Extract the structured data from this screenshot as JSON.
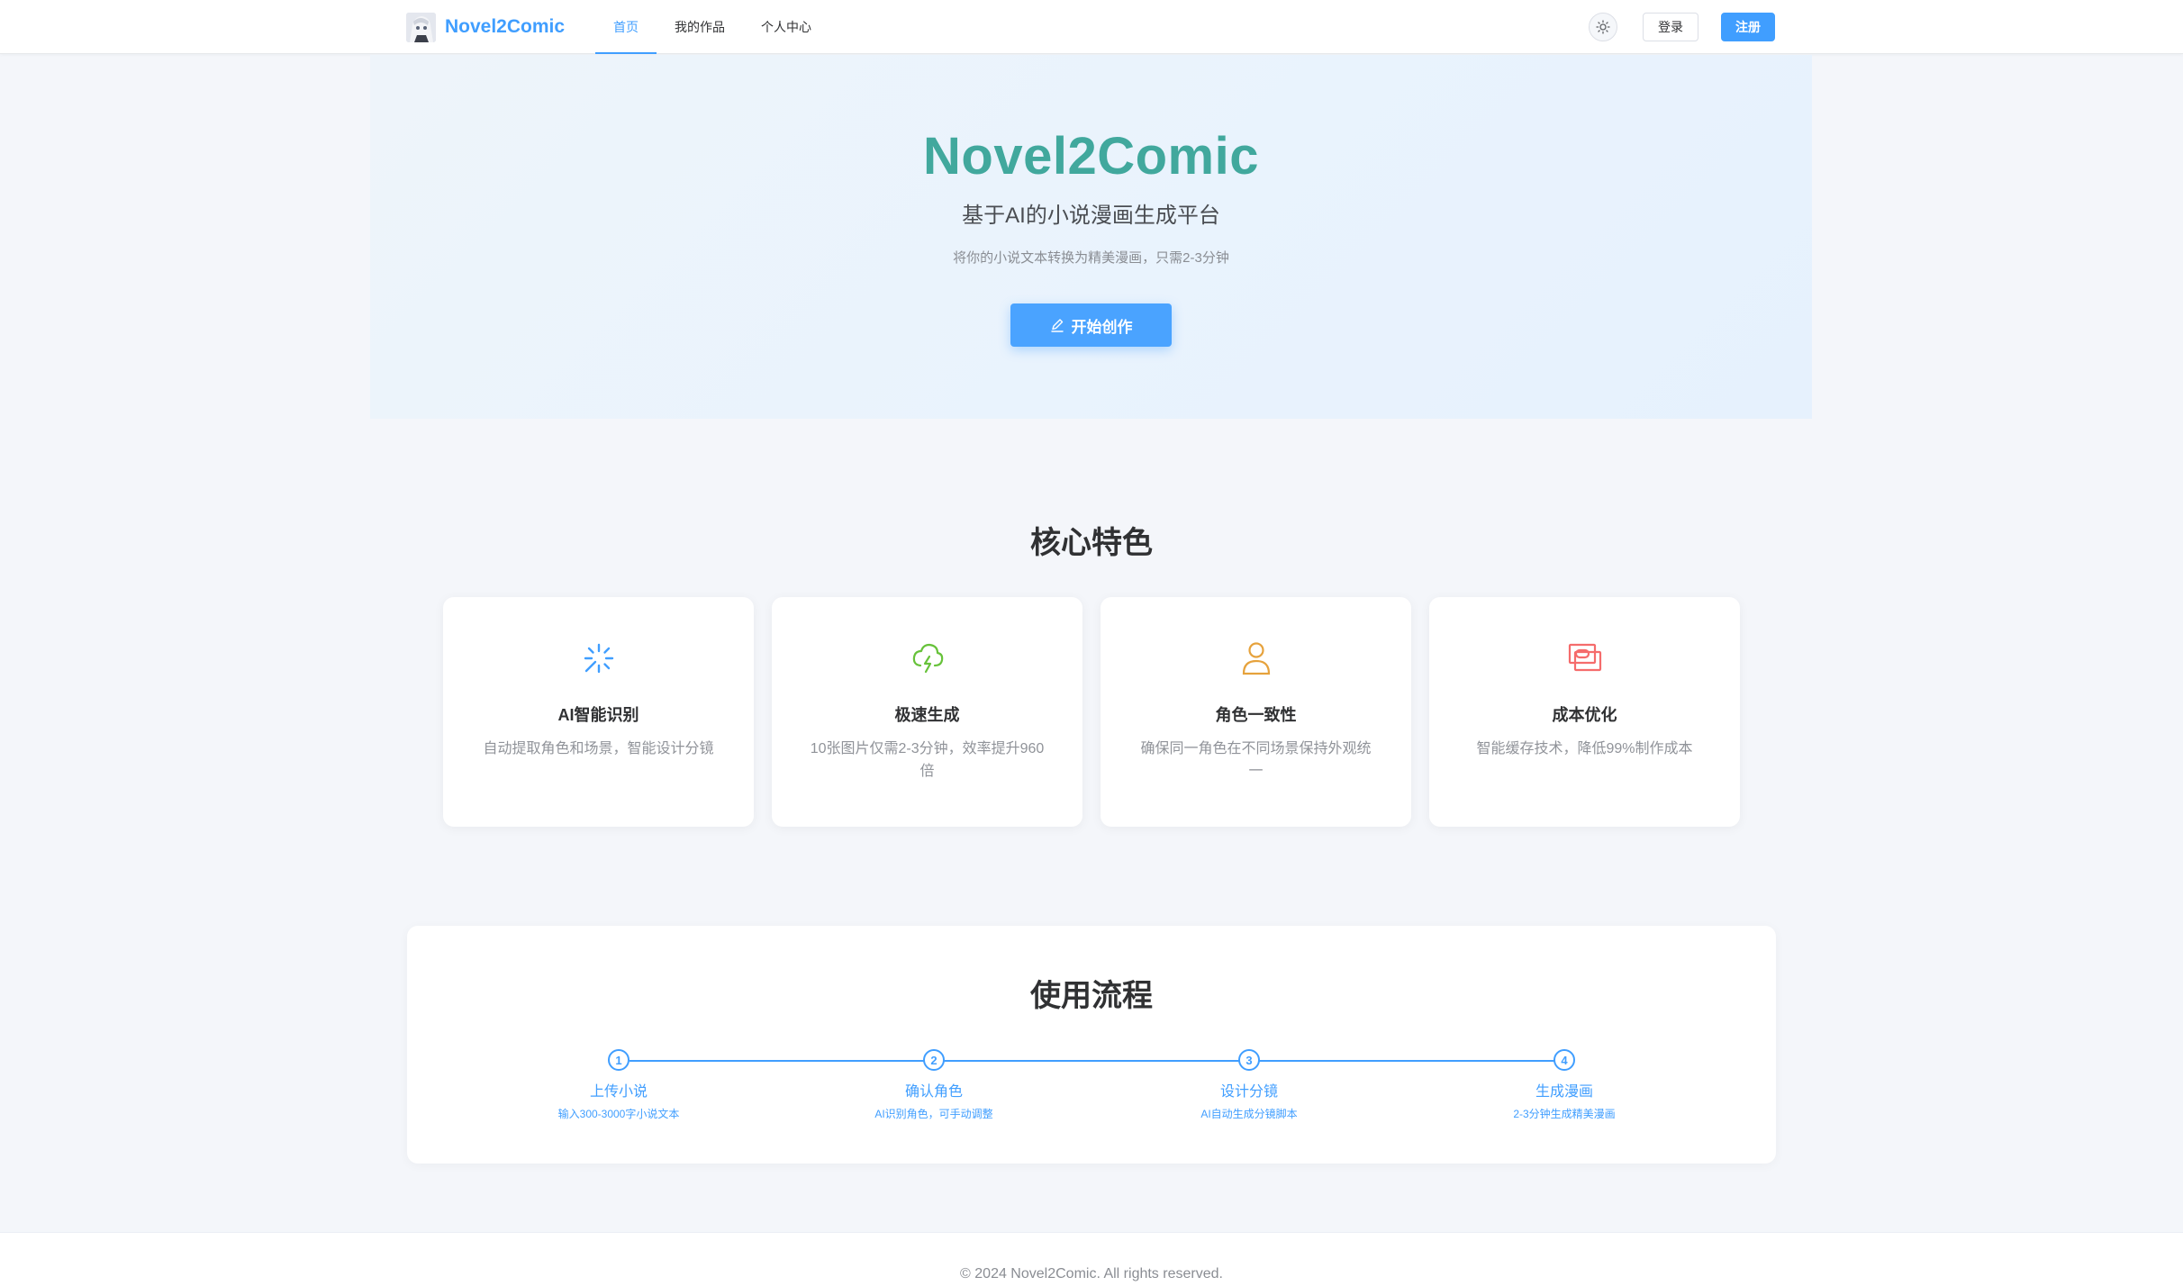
{
  "nav": {
    "brand": "Novel2Comic",
    "items": [
      {
        "label": "首页",
        "active": true
      },
      {
        "label": "我的作品",
        "active": false
      },
      {
        "label": "个人中心",
        "active": false
      }
    ],
    "theme_toggle_icon": "sun-icon",
    "login_label": "登录",
    "register_label": "注册"
  },
  "hero": {
    "title": "Novel2Comic",
    "subtitle": "基于AI的小说漫画生成平台",
    "description": "将你的小说文本转换为精美漫画，只需2-3分钟",
    "cta_label": "开始创作",
    "cta_icon": "edit-icon"
  },
  "features": {
    "title": "核心特色",
    "cards": [
      {
        "icon": "magic-sparkle-icon",
        "icon_color": "#409eff",
        "title": "AI智能识别",
        "desc": "自动提取角色和场景，智能设计分镜"
      },
      {
        "icon": "lightning-cloud-icon",
        "icon_color": "#67c23a",
        "title": "极速生成",
        "desc": "10张图片仅需2-3分钟，效率提升960倍"
      },
      {
        "icon": "user-icon",
        "icon_color": "#e6a23c",
        "title": "角色一致性",
        "desc": "确保同一角色在不同场景保持外观统一"
      },
      {
        "icon": "money-icon",
        "icon_color": "#f56c6c",
        "title": "成本优化",
        "desc": "智能缓存技术，降低99%制作成本"
      }
    ]
  },
  "steps": {
    "title": "使用流程",
    "items": [
      {
        "number": "1",
        "label": "上传小说",
        "desc": "输入300-3000字小说文本"
      },
      {
        "number": "2",
        "label": "确认角色",
        "desc": "AI识别角色，可手动调整"
      },
      {
        "number": "3",
        "label": "设计分镜",
        "desc": "AI自动生成分镜脚本"
      },
      {
        "number": "4",
        "label": "生成漫画",
        "desc": "2-3分钟生成精美漫画"
      }
    ]
  },
  "footer": {
    "text": "© 2024 Novel2Comic. All rights reserved."
  }
}
